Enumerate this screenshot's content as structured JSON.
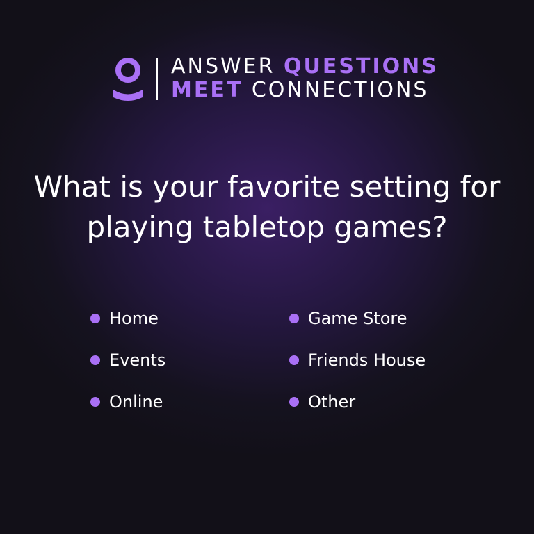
{
  "header": {
    "line1_light": "ANSWER",
    "line1_accent": "QUESTIONS",
    "line2_accent": "MEET",
    "line2_light": "CONNECTIONS",
    "icon": "person-icon"
  },
  "question": "What is your favorite setting for playing tabletop games?",
  "options": [
    "Home",
    "Game Store",
    "Events",
    "Friends House",
    "Online",
    "Other"
  ],
  "colors": {
    "accent": "#a970f5",
    "text": "#ffffff",
    "background": "#15121f"
  }
}
